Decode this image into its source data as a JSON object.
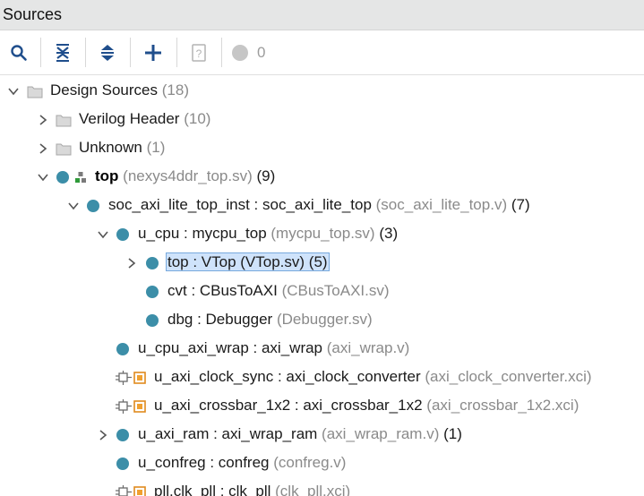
{
  "header": {
    "title": "Sources"
  },
  "toolbar": {
    "buttons": [
      "search",
      "collapse-all",
      "expand-all",
      "add-sources",
      "properties"
    ],
    "status_count": "0"
  },
  "tree": [
    {
      "name": "Design Sources",
      "suffix": "(18)",
      "expander": "down",
      "icon": "folder"
    },
    {
      "name": "Verilog Header",
      "suffix": "(10)",
      "expander": "right",
      "icon": "folder"
    },
    {
      "name": "Unknown",
      "suffix": "(1)",
      "expander": "right",
      "icon": "folder"
    },
    {
      "name": "top",
      "file": "(nexys4ddr_top.sv)",
      "count": "(9)",
      "expander": "down",
      "icon": "module-top"
    },
    {
      "name": "soc_axi_lite_top_inst : soc_axi_lite_top",
      "file": "(soc_axi_lite_top.v)",
      "count": "(7)",
      "expander": "down",
      "icon": "module"
    },
    {
      "name": "u_cpu : mycpu_top",
      "file": "(mycpu_top.sv)",
      "count": "(3)",
      "expander": "down",
      "icon": "module"
    },
    {
      "name": "top : VTop (VTop.sv) (5)",
      "expander": "right",
      "icon": "module",
      "selected": true
    },
    {
      "name": "cvt : CBusToAXI",
      "file": "(CBusToAXI.sv)",
      "icon": "module"
    },
    {
      "name": "dbg : Debugger",
      "file": "(Debugger.sv)",
      "icon": "module"
    },
    {
      "name": "u_cpu_axi_wrap : axi_wrap",
      "file": "(axi_wrap.v)",
      "icon": "module"
    },
    {
      "name": "u_axi_clock_sync : axi_clock_converter",
      "file": "(axi_clock_converter.xci)",
      "icon": "ip"
    },
    {
      "name": "u_axi_crossbar_1x2 : axi_crossbar_1x2",
      "file": "(axi_crossbar_1x2.xci)",
      "icon": "ip"
    },
    {
      "name": "u_axi_ram : axi_wrap_ram",
      "file": "(axi_wrap_ram.v)",
      "count": "(1)",
      "expander": "right",
      "icon": "module"
    },
    {
      "name": "u_confreg : confreg",
      "file": "(confreg.v)",
      "icon": "module"
    },
    {
      "name": "pll.clk_pll : clk_pll",
      "file": "(clk_pll.xci)",
      "icon": "ip"
    }
  ],
  "colors": {
    "module_dot": "#3c8ea8",
    "selection_fill": "#cfe3fb",
    "selection_border": "#78a9dd",
    "ip_orange": "#f0a030"
  }
}
